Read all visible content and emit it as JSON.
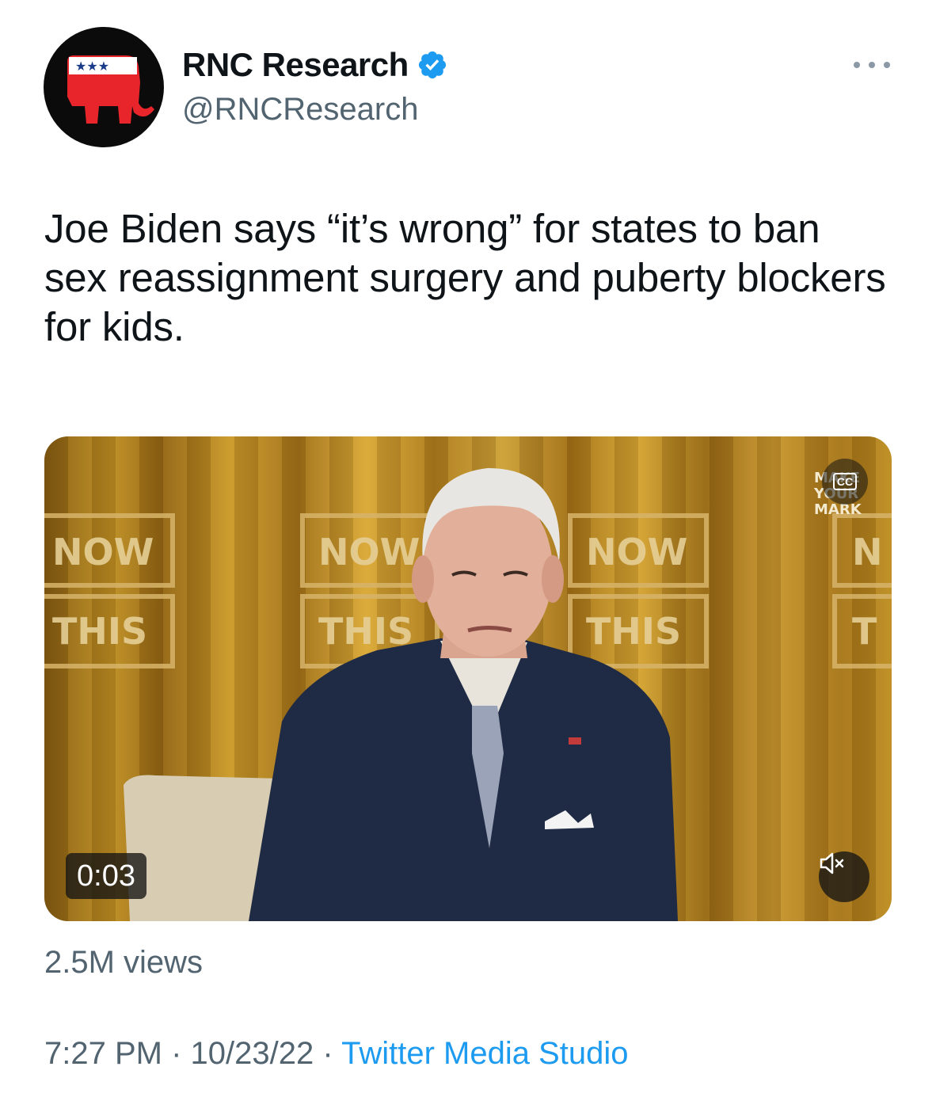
{
  "author": {
    "display_name": "RNC Research",
    "handle": "@RNCResearch",
    "verified": true,
    "avatar_icon": "gop-elephant-logo",
    "brand_color": "#e8252b"
  },
  "tweet": {
    "text": "Joe Biden says “it’s wrong” for states to ban sex reassignment surgery and puberty blockers for kids."
  },
  "media": {
    "type": "video",
    "duration_label": "0:03",
    "backdrop_signs": [
      {
        "top": "NOW",
        "bottom": "THIS"
      },
      {
        "top": "NOW",
        "bottom": "THIS"
      },
      {
        "top": "NOW",
        "bottom": "THIS"
      },
      {
        "top": "N",
        "bottom": "T"
      }
    ],
    "corner_logo_lines": [
      "MAKE",
      "YOUR",
      "MARK"
    ],
    "cc_label": "CC",
    "mute_icon": "speaker-muted-icon"
  },
  "stats": {
    "views_label": "2.5M views"
  },
  "meta": {
    "time": "7:27 PM",
    "date": "10/23/22",
    "separator": "·",
    "source": "Twitter Media Studio"
  },
  "colors": {
    "text_primary": "#0f1419",
    "text_secondary": "#536471",
    "link": "#1d9bf0",
    "verified": "#1d9bf0"
  }
}
